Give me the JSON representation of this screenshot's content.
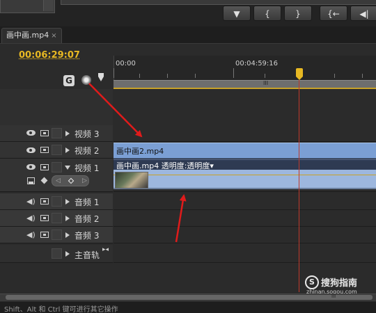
{
  "sequence_tab": {
    "title": "画中画.mp4",
    "close_glyph": "×"
  },
  "timecode": "00:06:29:07",
  "toolbar": {
    "buttons": [
      {
        "name": "marker-button",
        "glyph": "▼"
      },
      {
        "name": "set-in-button",
        "glyph": "{"
      },
      {
        "name": "set-out-button",
        "glyph": "}"
      },
      {
        "name": "go-to-in-button",
        "glyph": "{←"
      },
      {
        "name": "step-back-button",
        "glyph": "◀|"
      }
    ]
  },
  "header_icons": {
    "snap": "snap-icon",
    "marker_target": "marker-target-icon",
    "add_marker": "add-marker-icon",
    "snap_glyph": "G"
  },
  "ruler": {
    "start_label": "00:00",
    "mid_label": "00:04:59:16",
    "work_area_grip": "III"
  },
  "tracks": {
    "video": [
      {
        "label": "视频 3"
      },
      {
        "label": "视频 2"
      },
      {
        "label": "视频 1"
      }
    ],
    "audio": [
      {
        "label": "音频 1"
      },
      {
        "label": "音频 2"
      },
      {
        "label": "音频 3"
      }
    ],
    "master": {
      "label": "主音轨",
      "icon_glyph": "▸◂"
    }
  },
  "clips": {
    "video2": {
      "label": "画中画2.mp4"
    },
    "video1": {
      "label": "画中画.mp4  透明度:透明度▾"
    }
  },
  "keyframe_nav": {
    "prev": "◁",
    "next": "▷"
  },
  "scrollbar": {
    "grip": "III"
  },
  "status_bar": {
    "text": "Shift、Alt 和 Ctrl 键可进行其它操作"
  },
  "watermark": {
    "logo_glyph": "S",
    "text": "搜狗指南",
    "url": "zhinan.sogou.com"
  },
  "colors": {
    "timecode": "#e8b923",
    "playhead": "#c0392b",
    "clip_blue": "#7b9fd4",
    "arrow_red": "#e01b1b"
  }
}
